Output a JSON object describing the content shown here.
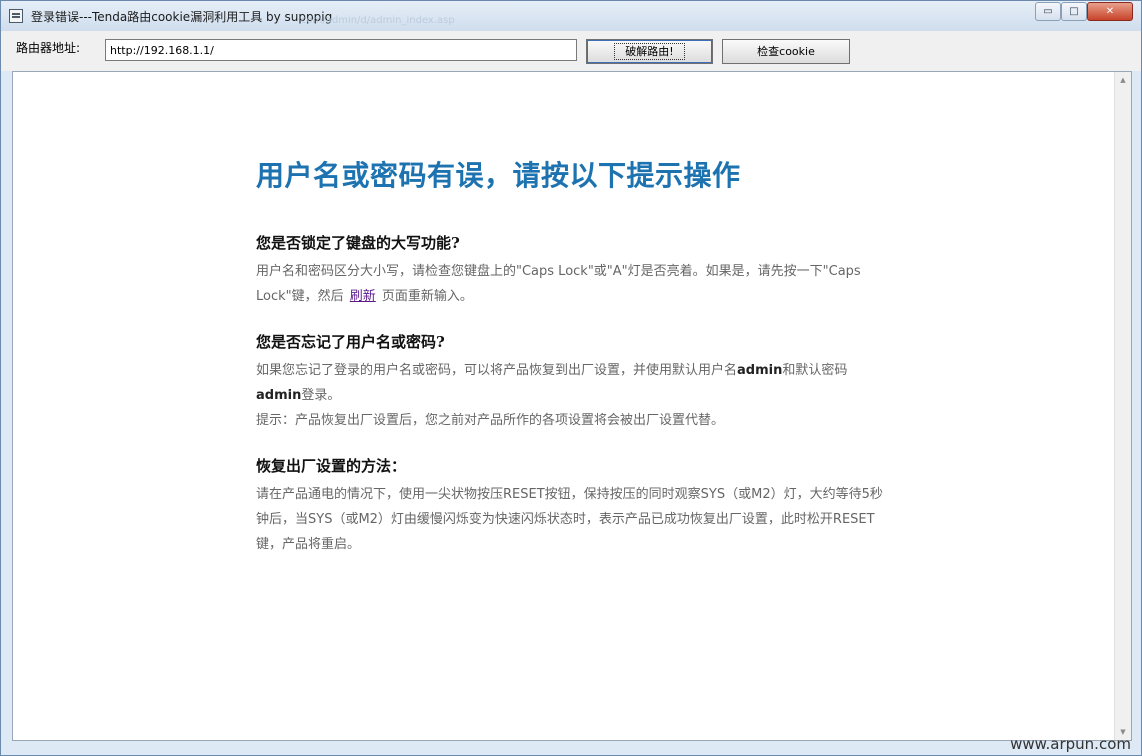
{
  "window": {
    "title": "登录错误---Tenda路由cookie漏洞利用工具 by supppig",
    "title_ghost": "com/admin/d/admin_index.asp",
    "min_glyph": "▭",
    "max_glyph": "□",
    "close_glyph": "✕"
  },
  "toolbar": {
    "address_label": "路由器地址:",
    "address_value": "http://192.168.1.1/",
    "crack_button": "破解路由!",
    "check_button": "检查cookie"
  },
  "page": {
    "heading": "用户名或密码有误，请按以下提示操作",
    "sections": [
      {
        "title": "您是否锁定了键盘的大写功能?",
        "p1_before": "用户名和密码区分大小写，请检查您键盘上的\"Caps Lock\"或\"A\"灯是否亮着。如果是，请先按一下\"Caps Lock\"键，然后",
        "link": "刷新",
        "p1_after": "页面重新输入。"
      },
      {
        "title": "您是否忘记了用户名或密码?",
        "p1_a": "如果您忘记了登录的用户名或密码，可以将产品恢复到出厂设置，并使用默认用户名",
        "p1_b": "admin",
        "p1_c": "和默认密码",
        "p1_d": "admin",
        "p1_e": "登录。",
        "p2": "提示：产品恢复出厂设置后，您之前对产品所作的各项设置将会被出厂设置代替。"
      },
      {
        "title": "恢复出厂设置的方法：",
        "p1": "请在产品通电的情况下，使用一尖状物按压RESET按钮，保持按压的同时观察SYS（或M2）灯，大约等待5秒钟后，当SYS（或M2）灯由缓慢闪烁变为快速闪烁状态时，表示产品已成功恢复出厂设置，此时松开RESET键，产品将重启。"
      }
    ]
  },
  "scrollbar": {
    "up_glyph": "▲",
    "down_glyph": "▼"
  },
  "watermark": "www.arpun.com",
  "colors": {
    "heading": "#1d72b0",
    "body_text": "#666666",
    "link": "#5b1a8a",
    "close_button": "#c8432a"
  }
}
